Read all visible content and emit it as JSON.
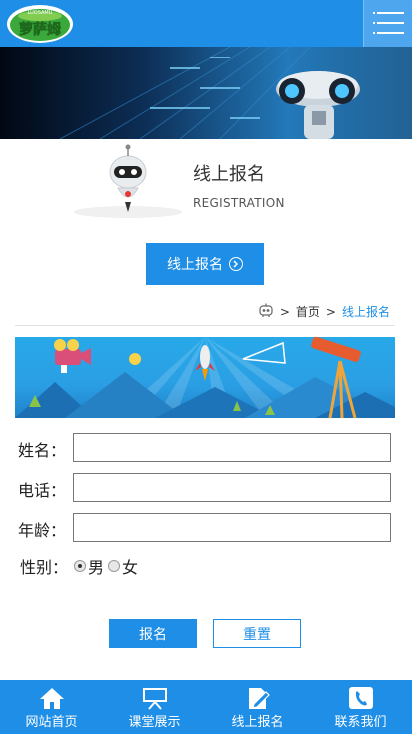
{
  "header": {
    "logo_text": "萝萨姆",
    "logo_sub": "LUOSAMU",
    "menu_icon": "hamburger-menu-icon"
  },
  "banner": {
    "image": "robot-banner"
  },
  "section": {
    "title": "线上报名",
    "subtitle": "REGISTRATION",
    "signup_button": "线上报名"
  },
  "breadcrumb": {
    "home": "首页",
    "separator": ">",
    "current": "线上报名"
  },
  "form": {
    "name_label": "姓名：",
    "phone_label": "电话：",
    "age_label": "年龄：",
    "gender_label": "性别：",
    "gender_options": [
      "男",
      "女"
    ],
    "gender_selected": "男",
    "submit_label": "报名",
    "reset_label": "重置"
  },
  "bottom_nav": {
    "items": [
      {
        "label": "网站首页",
        "icon": "home-icon"
      },
      {
        "label": "课堂展示",
        "icon": "classroom-icon"
      },
      {
        "label": "线上报名",
        "icon": "edit-icon"
      },
      {
        "label": "联系我们",
        "icon": "phone-icon"
      }
    ]
  },
  "colors": {
    "primary": "#1f8ee6",
    "header": "#1f8ee6",
    "logo_green": "#3aa83a"
  }
}
